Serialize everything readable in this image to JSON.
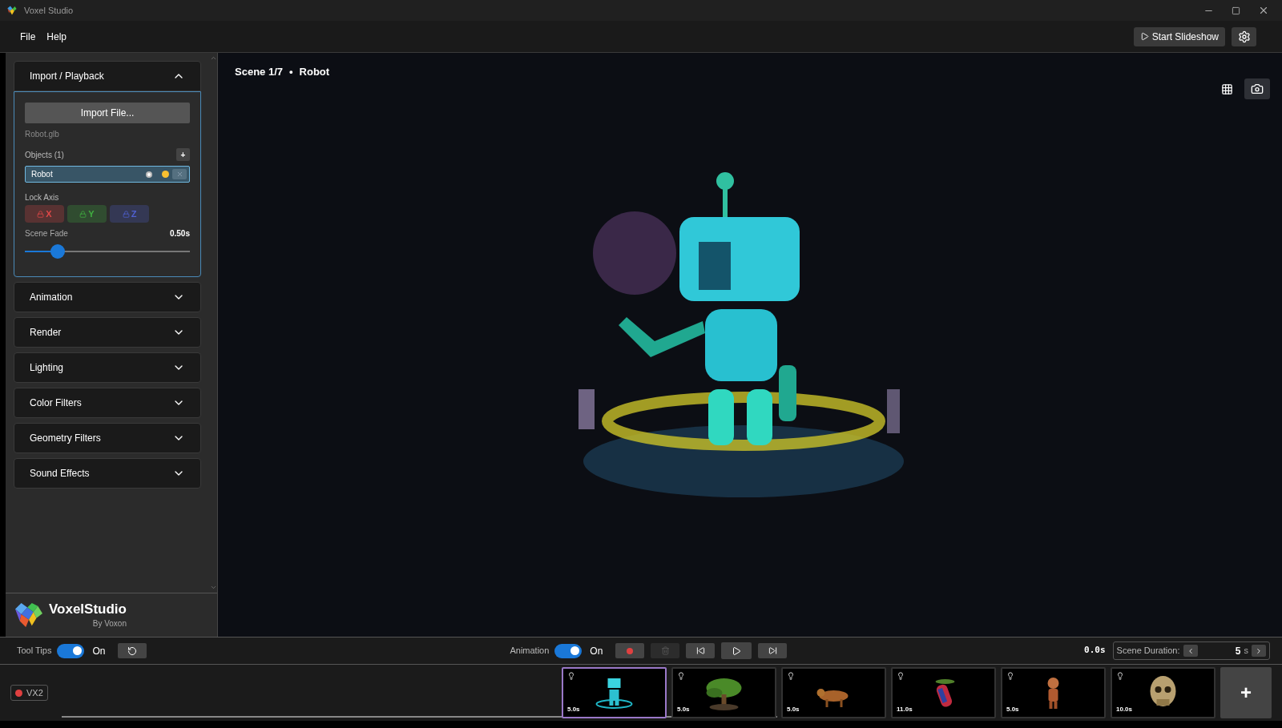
{
  "window": {
    "title": "Voxel Studio"
  },
  "menu": [
    "File",
    "Help"
  ],
  "start_slideshow": "Start Slideshow",
  "sections": [
    {
      "title": "Import / Playback",
      "expanded": true
    },
    {
      "title": "Animation",
      "expanded": false
    },
    {
      "title": "Render",
      "expanded": false
    },
    {
      "title": "Lighting",
      "expanded": false
    },
    {
      "title": "Color Filters",
      "expanded": false
    },
    {
      "title": "Geometry Filters",
      "expanded": false
    },
    {
      "title": "Sound Effects",
      "expanded": false
    }
  ],
  "import_panel": {
    "import_button": "Import File...",
    "file_name": "Robot.glb",
    "objects_label": "Objects (1)",
    "add_button": "+",
    "objects": [
      {
        "name": "Robot",
        "selected": true
      }
    ],
    "lock_axis_label": "Lock Axis",
    "axes": [
      {
        "label": "X",
        "color": "#e04848",
        "locked": false
      },
      {
        "label": "Y",
        "color": "#40b040",
        "locked": false
      },
      {
        "label": "Z",
        "color": "#5060d0",
        "locked": false
      }
    ],
    "fade_label": "Scene Fade",
    "fade_value": "0.50s",
    "fade_slider": {
      "level": 0.2
    }
  },
  "logo": {
    "name": "VoxelStudio",
    "byline": "By Voxon"
  },
  "viewport": {
    "scene": "Scene 1/7",
    "separator": "•",
    "object": "Robot"
  },
  "toolbar": {
    "tooltips_label": "Tool Tips",
    "tooltips_on": true,
    "tooltips_state": "On",
    "animation_label": "Animation",
    "animation_on": true,
    "animation_state": "On",
    "time": "0.0s",
    "duration_label": "Scene Duration:",
    "duration_value": "5",
    "duration_unit": "s"
  },
  "device": {
    "label": "VX2",
    "color": "#e04040"
  },
  "scenes": [
    {
      "duration": "5.0s",
      "selected": true
    },
    {
      "duration": "5.0s",
      "selected": false
    },
    {
      "duration": "5.0s",
      "selected": false
    },
    {
      "duration": "11.0s",
      "selected": false
    },
    {
      "duration": "5.0s",
      "selected": false
    },
    {
      "duration": "10.0s",
      "selected": false
    }
  ],
  "add_scene": "+"
}
